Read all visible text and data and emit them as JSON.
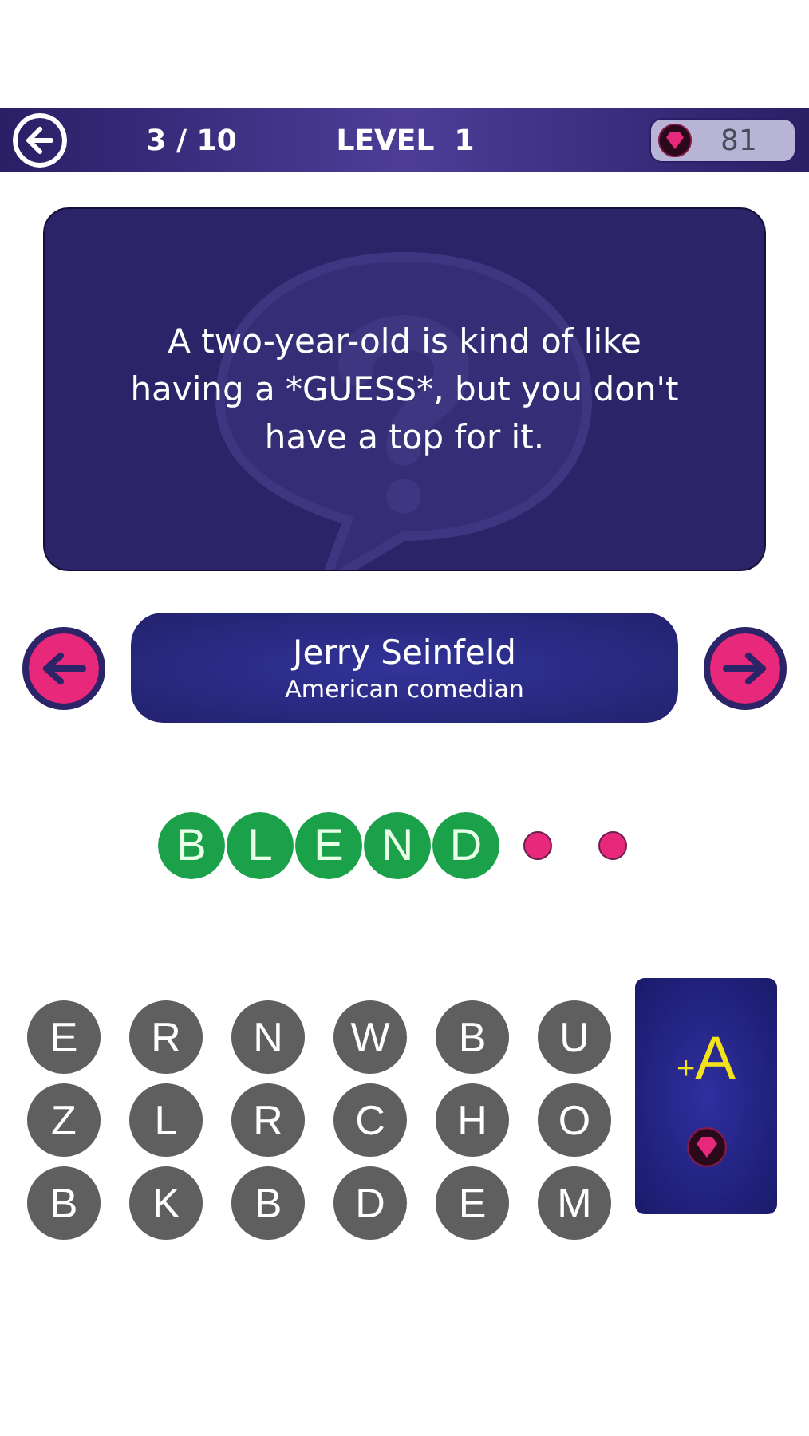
{
  "header": {
    "progress": "3 / 10",
    "level": "LEVEL  1",
    "gems": "81"
  },
  "quote": "A two-year-old is kind of like having a *GUESS*, but you don't have a top for it.",
  "author": {
    "name": "Jerry Seinfeld",
    "description": "American comedian"
  },
  "answer_slots": [
    {
      "kind": "filled",
      "letter": "B"
    },
    {
      "kind": "filled",
      "letter": "L"
    },
    {
      "kind": "filled",
      "letter": "E"
    },
    {
      "kind": "filled",
      "letter": "N"
    },
    {
      "kind": "filled",
      "letter": "D"
    },
    {
      "kind": "empty"
    },
    {
      "kind": "empty"
    }
  ],
  "letters": [
    "E",
    "R",
    "N",
    "W",
    "B",
    "U",
    "Z",
    "L",
    "R",
    "C",
    "H",
    "O",
    "B",
    "K",
    "B",
    "D",
    "E",
    "M"
  ],
  "hint": {
    "label": "$_{+}$A"
  }
}
